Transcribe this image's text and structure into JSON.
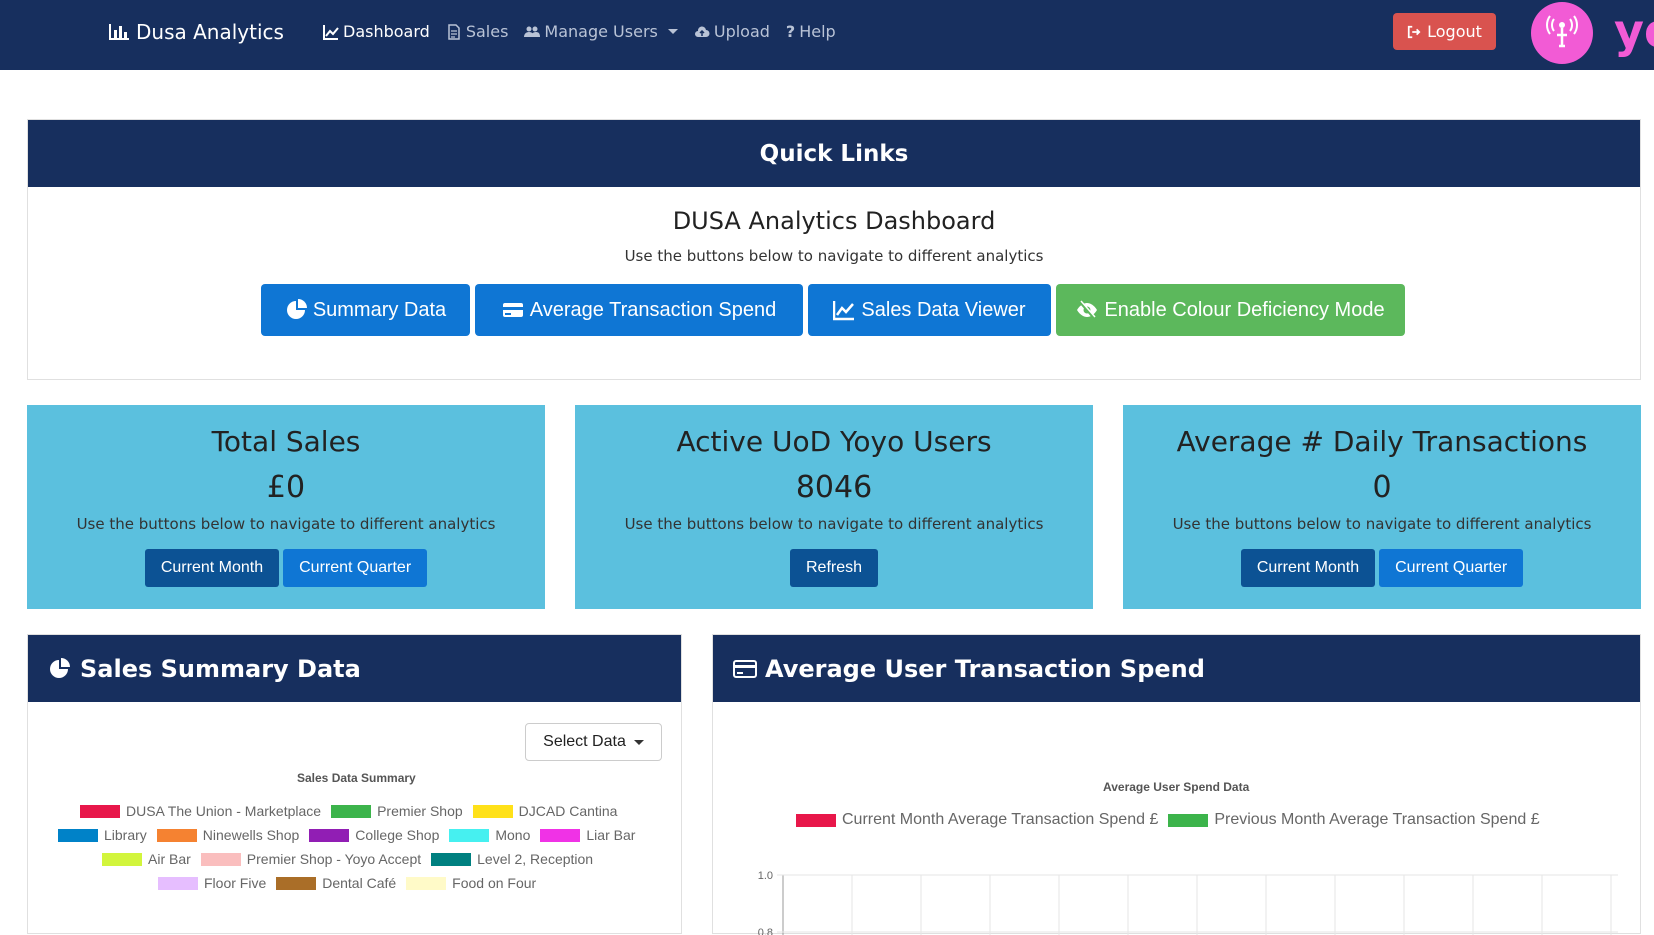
{
  "nav": {
    "brand": "Dusa Analytics",
    "links": [
      {
        "label": "Dashboard",
        "icon": "chart-line-icon",
        "active": true
      },
      {
        "label": "Sales",
        "icon": "document-icon"
      },
      {
        "label": "Manage Users",
        "icon": "users-icon",
        "dropdown": true
      },
      {
        "label": "Upload",
        "icon": "cloud-upload-icon"
      },
      {
        "label": "Help",
        "icon": "question-icon"
      }
    ],
    "logout": "Logout",
    "logo_text": "yo"
  },
  "quick_links": {
    "header": "Quick Links",
    "title": "DUSA Analytics Dashboard",
    "subtitle": "Use the buttons below to navigate to different analytics",
    "buttons": [
      {
        "label": "Summary Data",
        "icon": "pie-chart-icon"
      },
      {
        "label": "Average Transaction Spend",
        "icon": "credit-card-icon"
      },
      {
        "label": "Sales Data Viewer",
        "icon": "chart-line-icon"
      },
      {
        "label": "Enable Colour Deficiency Mode",
        "icon": "eye-slash-icon"
      }
    ]
  },
  "stats": [
    {
      "title": "Total Sales",
      "value": "£0",
      "desc": "Use the buttons below to navigate to different analytics",
      "buttons": [
        "Current Month",
        "Current Quarter"
      ]
    },
    {
      "title": "Active UoD Yoyo Users",
      "value": "8046",
      "desc": "Use the buttons below to navigate to different analytics",
      "buttons": [
        "Refresh"
      ]
    },
    {
      "title": "Average # Daily Transactions",
      "value": "0",
      "desc": "Use the buttons below to navigate to different analytics",
      "buttons": [
        "Current Month",
        "Current Quarter"
      ]
    }
  ],
  "sales_summary": {
    "header": "Sales Summary Data",
    "select_label": "Select Data",
    "chart_title": "Sales Data Summary",
    "legend": [
      {
        "label": "DUSA The Union - Marketplace",
        "color": "#e8174a"
      },
      {
        "label": "Premier Shop",
        "color": "#3cb44b"
      },
      {
        "label": "DJCAD Cantina",
        "color": "#ffe119"
      },
      {
        "label": "Library",
        "color": "#0082c8"
      },
      {
        "label": "Ninewells Shop",
        "color": "#f58231"
      },
      {
        "label": "College Shop",
        "color": "#911eb4"
      },
      {
        "label": "Mono",
        "color": "#46f0f0"
      },
      {
        "label": "Liar Bar",
        "color": "#f032e6"
      },
      {
        "label": "Air Bar",
        "color": "#d2f53c"
      },
      {
        "label": "Premier Shop - Yoyo Accept",
        "color": "#fabebe"
      },
      {
        "label": "Level 2, Reception",
        "color": "#008080"
      },
      {
        "label": "Floor Five",
        "color": "#e6beff"
      },
      {
        "label": "Dental Café",
        "color": "#aa6e28"
      },
      {
        "label": "Food on Four",
        "color": "#fffac8"
      }
    ]
  },
  "avg_spend": {
    "header": "Average User Transaction Spend",
    "chart_data": {
      "type": "bar",
      "title": "Average User Spend Data",
      "series": [
        {
          "name": "Current Month Average Transaction Spend £",
          "color": "#e8174a",
          "values": []
        },
        {
          "name": "Previous Month Average Transaction Spend £",
          "color": "#3cb44b",
          "values": []
        }
      ],
      "y_ticks": [
        "1.0",
        "0.8"
      ],
      "ylim": [
        0,
        1.0
      ]
    }
  }
}
